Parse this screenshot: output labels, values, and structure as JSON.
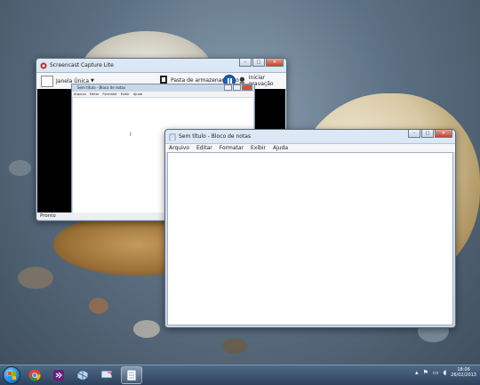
{
  "screencast": {
    "title": "Screencast Capture Lite",
    "selection_label": "Janela Única",
    "storage_button": "Pasta de armazenamento",
    "record_button": "Iniciar gravação",
    "status": "Pronto",
    "mini_notepad": {
      "title": "Sem título - Bloco de notas",
      "menu": [
        "Arquivo",
        "Editar",
        "Formatar",
        "Exibir",
        "Ajuda"
      ]
    }
  },
  "notepad": {
    "title": "Sem título - Bloco de notas",
    "menu": [
      "Arquivo",
      "Editar",
      "Formatar",
      "Exibir",
      "Ajuda"
    ]
  },
  "window_controls": {
    "minimize": "–",
    "maximize": "□",
    "close": "✕"
  },
  "taskbar": {
    "apps": [
      "chrome-icon",
      "visual-studio-icon",
      "virtualbox-icon",
      "remote-desktop-icon",
      "notepad-icon"
    ],
    "time": "18:06",
    "date": "26/02/2013",
    "tray_icons": [
      "show-hidden-icons",
      "action-center-icon",
      "network-icon",
      "volume-icon"
    ]
  },
  "colors": {
    "accent_blue": "#1f5fb8",
    "close_red": "#c7442a",
    "taskbar": "#2d425c"
  }
}
